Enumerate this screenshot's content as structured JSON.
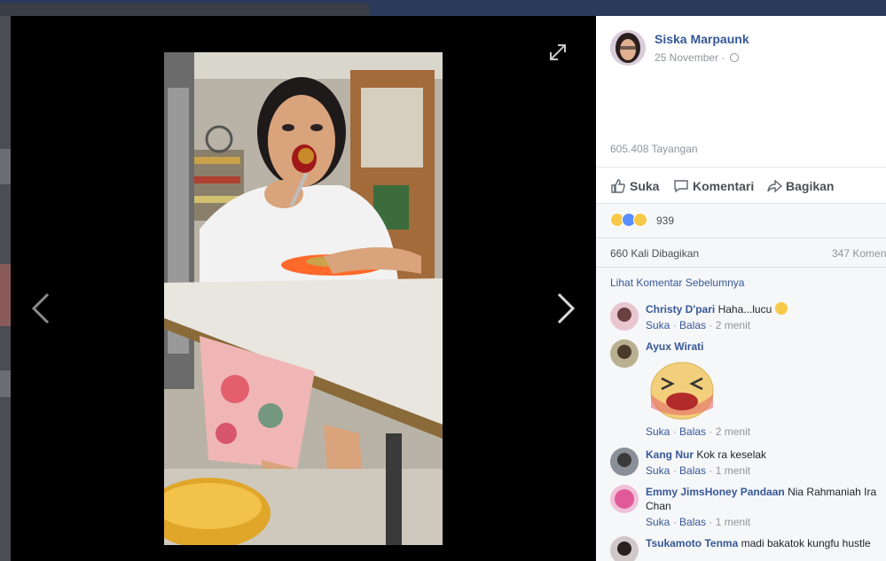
{
  "post": {
    "author": "Siska Marpaunk",
    "date": "25 November ·",
    "views": "605.408 Tayangan"
  },
  "actions": {
    "like": "Suka",
    "comment": "Komentari",
    "share": "Bagikan"
  },
  "reactions": {
    "icons": [
      "haha-icon",
      "like-icon",
      "wow-icon"
    ],
    "count": "939"
  },
  "stats": {
    "shares": "660 Kali Dibagikan",
    "comments": "347 Komen"
  },
  "previous_comments_label": "Lihat Komentar Sebelumnya",
  "comments": [
    {
      "name": "Christy D'pari",
      "text": "Haha...lucu",
      "like": "Suka",
      "reply": "Balas",
      "time": "2 menit"
    },
    {
      "name": "Ayux Wirati",
      "text": "",
      "like": "Suka",
      "reply": "Balas",
      "time": "2 menit"
    },
    {
      "name": "Kang Nur",
      "text": "Kok ra keselak",
      "like": "Suka",
      "reply": "Balas",
      "time": "1 menit"
    },
    {
      "name": "Emmy JimsHoney Pandaan",
      "text": "Nia Rahmaniah Ira Chan",
      "like": "Suka",
      "reply": "Balas",
      "time": "1 menit"
    },
    {
      "name": "Tsukamoto Tenma",
      "text": "madi bakatok kungfu hustle"
    }
  ],
  "meta_sep": " · ",
  "colors": {
    "link": "#365899",
    "muted": "#90949c",
    "like_blue": "#5890ff",
    "haha_yellow": "#f7c948"
  }
}
